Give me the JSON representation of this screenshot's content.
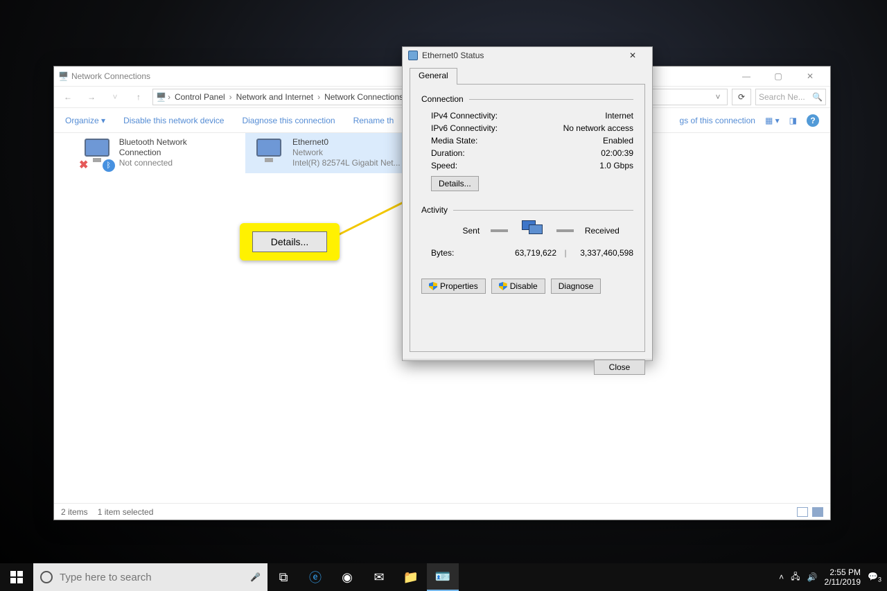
{
  "nc": {
    "title": "Network Connections",
    "breadcrumb": [
      "Control Panel",
      "Network and Internet",
      "Network Connections"
    ],
    "search_placeholder": "Search Ne...",
    "commands": {
      "organize": "Organize ▾",
      "disable": "Disable this network device",
      "diagnose": "Diagnose this connection",
      "rename": "Rename th",
      "view_status": "gs of this connection"
    },
    "adapters": [
      {
        "name": "Bluetooth Network Connection",
        "line2": "",
        "line3": "Not connected"
      },
      {
        "name": "Ethernet0",
        "line2": "Network",
        "line3": "Intel(R) 82574L Gigabit Net..."
      }
    ],
    "status_left": "2 items",
    "status_sel": "1 item selected"
  },
  "callout": {
    "label": "Details..."
  },
  "dlg": {
    "title": "Ethernet0 Status",
    "tab": "General",
    "connection_label": "Connection",
    "conn": [
      {
        "k": "IPv4 Connectivity:",
        "v": "Internet"
      },
      {
        "k": "IPv6 Connectivity:",
        "v": "No network access"
      },
      {
        "k": "Media State:",
        "v": "Enabled"
      },
      {
        "k": "Duration:",
        "v": "02:00:39"
      },
      {
        "k": "Speed:",
        "v": "1.0 Gbps"
      }
    ],
    "details_btn": "Details...",
    "activity_label": "Activity",
    "sent_label": "Sent",
    "received_label": "Received",
    "bytes_label": "Bytes:",
    "bytes_sent": "63,719,622",
    "bytes_recv": "3,337,460,598",
    "properties": "Properties",
    "disable": "Disable",
    "diagnose": "Diagnose",
    "close": "Close"
  },
  "taskbar": {
    "search_placeholder": "Type here to search",
    "time": "2:55 PM",
    "date": "2/11/2019",
    "notif": "3"
  }
}
